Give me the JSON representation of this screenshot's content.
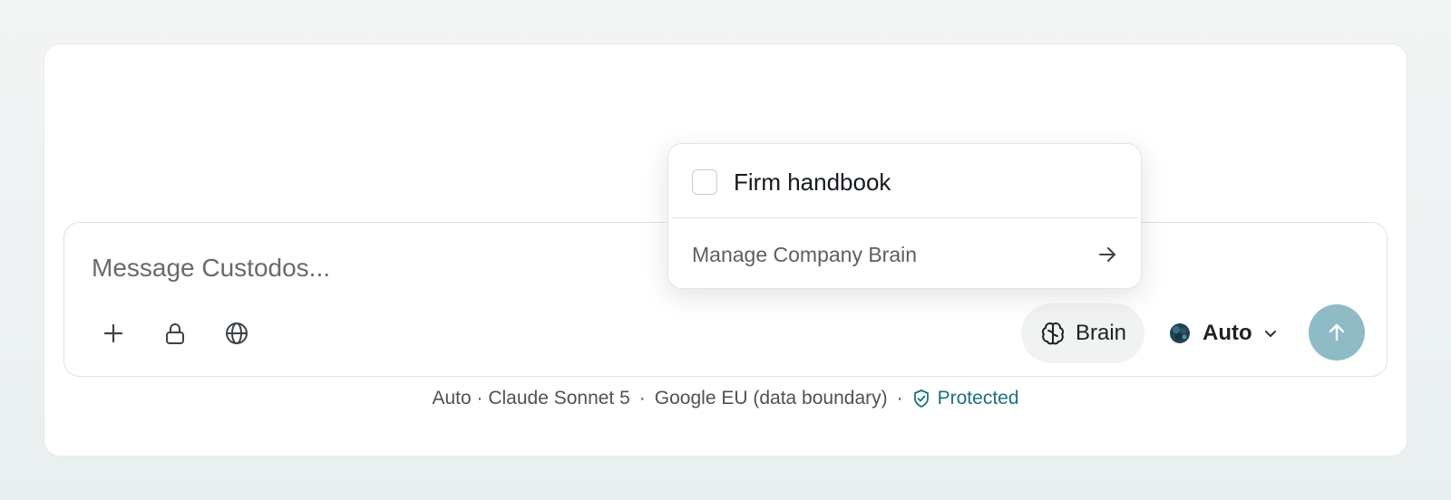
{
  "composer": {
    "placeholder": "Message Custodos...",
    "tools": [
      {
        "name": "attach",
        "icon": "plus-icon"
      },
      {
        "name": "private",
        "icon": "lock-icon"
      },
      {
        "name": "web",
        "icon": "globe-icon"
      }
    ],
    "brain_label": "Brain",
    "brain_icon": "brain-icon",
    "model_label": "Auto",
    "model_icon": "model-logo-icon",
    "send_icon": "arrow-up-icon"
  },
  "footer": {
    "model": "Auto · Claude Sonnet 5",
    "region": "Google EU (data boundary)",
    "separator": "·",
    "status": "Protected",
    "status_icon": "shield-check-icon"
  },
  "brain_menu": {
    "items": [
      {
        "label": "Firm handbook",
        "checked": false
      }
    ],
    "manage_label": "Manage Company Brain",
    "manage_icon": "arrow-right-icon"
  },
  "colors": {
    "accent": "#1f6f7f",
    "send_button": "#8fbbc6",
    "brain_chip_bg": "#f1f2f2"
  }
}
